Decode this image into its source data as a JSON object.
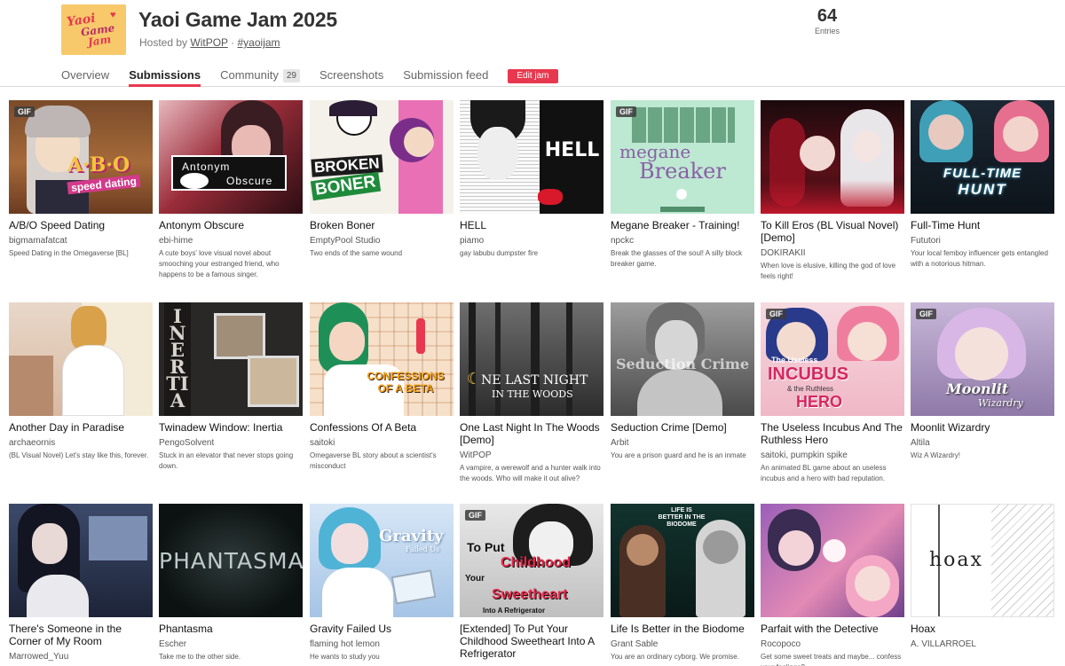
{
  "jam": {
    "logo_lines": [
      "Yaoi",
      "Game",
      "Jam"
    ],
    "title": "Yaoi Game Jam 2025",
    "hosted_prefix": "Hosted by ",
    "host": "WitPOP",
    "separator": " · ",
    "hashtag": "#yaoijam",
    "entries_count": "64",
    "entries_label": "Entries"
  },
  "tabs": [
    {
      "label": "Overview"
    },
    {
      "label": "Submissions"
    },
    {
      "label": "Community",
      "badge": "29"
    },
    {
      "label": "Screenshots"
    },
    {
      "label": "Submission feed"
    }
  ],
  "edit_button": "Edit jam",
  "gif_label": "GIF",
  "games": [
    {
      "title": "A/B/O Speed Dating",
      "author": "bigmamafatcat",
      "desc": "Speed Dating in the Omegaverse [BL]",
      "thumb_text": "A·B·O Speed Dating",
      "gif": true
    },
    {
      "title": "Antonym Obscure",
      "author": "ebi-hime",
      "desc": "A cute boys' love visual novel about smooching your estranged friend, who happens to be a famous singer.",
      "thumb_text": "Antonym Obscure",
      "gif": false
    },
    {
      "title": "Broken Boner",
      "author": "EmptyPool Studio",
      "desc": "Two ends of the same wound",
      "thumb_text": "BROKEN BONER",
      "gif": false
    },
    {
      "title": "HELL",
      "author": "piamo",
      "desc": "gay labubu dumpster fire",
      "thumb_text": "HELL",
      "gif": false
    },
    {
      "title": "Megane Breaker - Training!",
      "author": "npckc",
      "desc": "Break the glasses of the soul! A silly block breaker game.",
      "thumb_text": "Megane Breaker",
      "gif": true
    },
    {
      "title": "To Kill Eros (BL Visual Novel) [Demo]",
      "author": "DOKIRAKII",
      "desc": "When love is elusive, killing the god of love feels right!",
      "thumb_text": "",
      "gif": false
    },
    {
      "title": "Full-Time Hunt",
      "author": "Fututori",
      "desc": "Your local femboy influencer gets entangled with a notorious hitman.",
      "thumb_text": "FULL-TIME HUNT",
      "gif": false
    },
    {
      "title": "Another Day in Paradise",
      "author": "archaeornis",
      "desc": "(BL Visual Novel) Let's stay like this, forever.",
      "thumb_text": "",
      "gif": false
    },
    {
      "title": "Twinadew Window: Inertia",
      "author": "PengoSolvent",
      "desc": "Stuck in an elevator that never stops going down.",
      "thumb_text": "INERTIA",
      "gif": false
    },
    {
      "title": "Confessions Of A Beta",
      "author": "saitoki",
      "desc": "Omegaverse BL story about a scientist's misconduct",
      "thumb_text": "CONFESSIONS OF A BETA",
      "gif": false
    },
    {
      "title": "One Last Night In The Woods [Demo]",
      "author": "WitPOP",
      "desc": "A vampire, a werewolf and a hunter walk into the woods. Who will make it out alive?",
      "thumb_text": "One Last Night In The Woods",
      "gif": false
    },
    {
      "title": "Seduction Crime [Demo]",
      "author": "Arbit",
      "desc": "You are a prison guard and he is an inmate",
      "thumb_text": "Seduction Crime",
      "gif": false
    },
    {
      "title": "The Useless Incubus And The Ruthless Hero",
      "author": "saitoki, pumpkin spike",
      "desc": "An animated BL game about an useless incubus and a hero with bad reputation.",
      "thumb_text": "The Useless INCUBUS & the Ruthless HERO",
      "gif": true
    },
    {
      "title": "Moonlit Wizardry",
      "author": "Altila",
      "desc": "Wiz A Wizardry!",
      "thumb_text": "Moonlit Wizardry",
      "gif": true
    },
    {
      "title": "There's Someone in the Corner of My Room",
      "author": "Marrowed_Yuu",
      "desc": "",
      "thumb_text": "",
      "gif": false
    },
    {
      "title": "Phantasma",
      "author": "Escher",
      "desc": "Take me to the other side.",
      "thumb_text": "PHANTASMA",
      "gif": false
    },
    {
      "title": "Gravity Failed Us",
      "author": "flaming hot lemon",
      "desc": "He wants to study you",
      "thumb_text": "Gravity Failed Us",
      "gif": false
    },
    {
      "title": "[Extended] To Put Your Childhood Sweetheart Into A Refrigerator",
      "author": "",
      "desc": "",
      "thumb_text": "To Put Your Childhood Sweetheart Into A Refrigerator",
      "gif": true
    },
    {
      "title": "Life Is Better in the Biodome",
      "author": "Grant Sable",
      "desc": "You are an ordinary cyborg. We promise.",
      "thumb_text": "Life Is Better in the Biodome",
      "gif": false
    },
    {
      "title": "Parfait with the Detective",
      "author": "Rocopoco",
      "desc": "Get some sweet treats and maybe... confess your feelings?",
      "thumb_text": "",
      "gif": false
    },
    {
      "title": "Hoax",
      "author": "A. VILLARROEL",
      "desc": "",
      "thumb_text": "hoax",
      "gif": false
    }
  ],
  "colors": {
    "accent": "#e8384f",
    "text": "#222222",
    "muted": "#555555"
  }
}
